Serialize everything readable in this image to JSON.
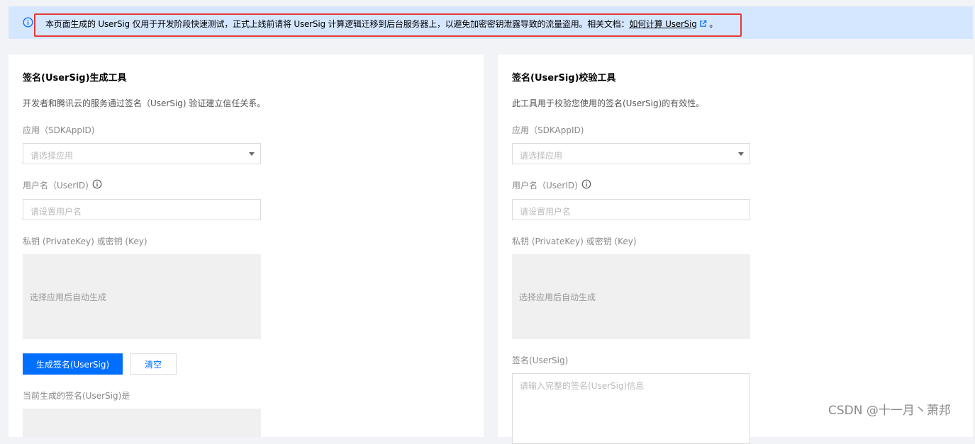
{
  "notice": {
    "text": "本页面生成的 UserSig 仅用于开发阶段快速测试，正式上线前请将 UserSig 计算逻辑迁移到后台服务器上，以避免加密密钥泄露导致的流量盗用。相关文档：",
    "link_label": "如何计算 UserSig",
    "suffix": "。"
  },
  "generator": {
    "title": "签名(UserSig)生成工具",
    "description": "开发者和腾讯云的服务通过签名（UserSig) 验证建立信任关系。",
    "app_label": "应用（SDKAppID)",
    "app_placeholder": "请选择应用",
    "user_label": "用户名（UserID)",
    "user_placeholder": "请设置用户名",
    "key_label": "私钥 (PrivateKey) 或密钥 (Key)",
    "key_placeholder": "选择应用后自动生成",
    "generate_button": "生成签名(UserSig)",
    "clear_button": "清空",
    "result_label": "当前生成的签名(UserSig)是"
  },
  "verifier": {
    "title": "签名(UserSig)校验工具",
    "description": "此工具用于校验您使用的签名(UserSig)的有效性。",
    "app_label": "应用（SDKAppID)",
    "app_placeholder": "请选择应用",
    "user_label": "用户名（UserID)",
    "user_placeholder": "请设置用户名",
    "key_label": "私钥 (PrivateKey) 或密钥 (Key)",
    "key_placeholder": "选择应用后自动生成",
    "sig_label": "签名(UserSig)",
    "sig_placeholder": "请输入完整的签名(UserSig)信息"
  },
  "watermark": "CSDN @十一月丶萧邦",
  "colors": {
    "primary": "#006eff",
    "notice_bg": "#d5e7ff",
    "highlight_outline": "#e53935"
  }
}
